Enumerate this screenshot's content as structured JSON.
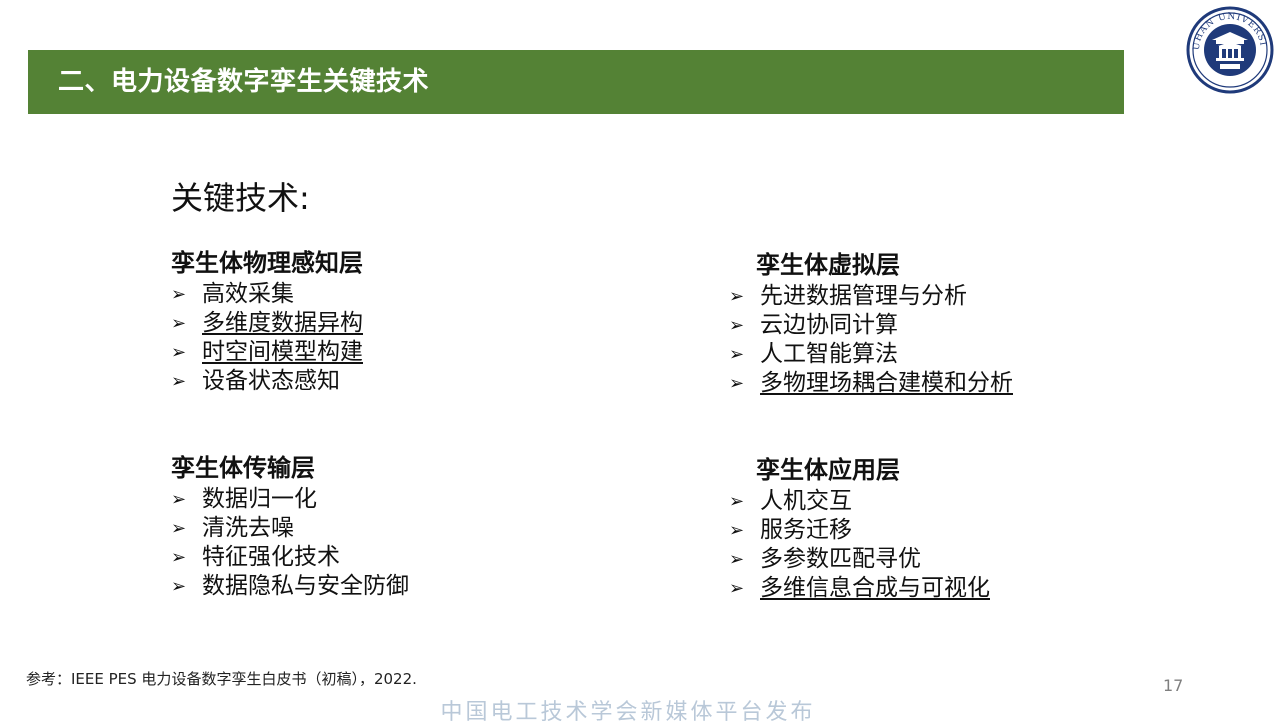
{
  "header": {
    "title": "二、电力设备数字孪生关键技术"
  },
  "logo": {
    "icon": "university-seal-icon",
    "text": "WUHAN UNIVERSITY",
    "color": "#1f3a7a"
  },
  "colors": {
    "title_bar": "#548235"
  },
  "main": {
    "heading": "关键技术:",
    "sections": [
      {
        "title": "孪生体物理感知层",
        "items": [
          {
            "text": "高效采集",
            "underline": false
          },
          {
            "text": "多维度数据异构",
            "underline": true
          },
          {
            "text": "时空间模型构建",
            "underline": true
          },
          {
            "text": "设备状态感知",
            "underline": false
          }
        ]
      },
      {
        "title": "孪生体虚拟层",
        "items": [
          {
            "text": "先进数据管理与分析",
            "underline": false
          },
          {
            "text": "云边协同计算",
            "underline": false
          },
          {
            "text": "人工智能算法",
            "underline": false
          },
          {
            "text": "多物理场耦合建模和分析",
            "underline": true
          }
        ]
      },
      {
        "title": "孪生体传输层",
        "items": [
          {
            "text": "数据归一化",
            "underline": false
          },
          {
            "text": "清洗去噪",
            "underline": false
          },
          {
            "text": "特征强化技术",
            "underline": false
          },
          {
            "text": "数据隐私与安全防御",
            "underline": false
          }
        ]
      },
      {
        "title": "孪生体应用层",
        "items": [
          {
            "text": "人机交互",
            "underline": false
          },
          {
            "text": "服务迁移",
            "underline": false
          },
          {
            "text": "多参数匹配寻优",
            "underline": false
          },
          {
            "text": "多维信息合成与可视化",
            "underline": true
          }
        ]
      }
    ],
    "bullet_glyph": "➢"
  },
  "footer": {
    "reference": "参考：IEEE PES 电力设备数字孪生白皮书（初稿），2022.",
    "page_number": "17",
    "watermark": "中国电工技术学会新媒体平台发布"
  }
}
